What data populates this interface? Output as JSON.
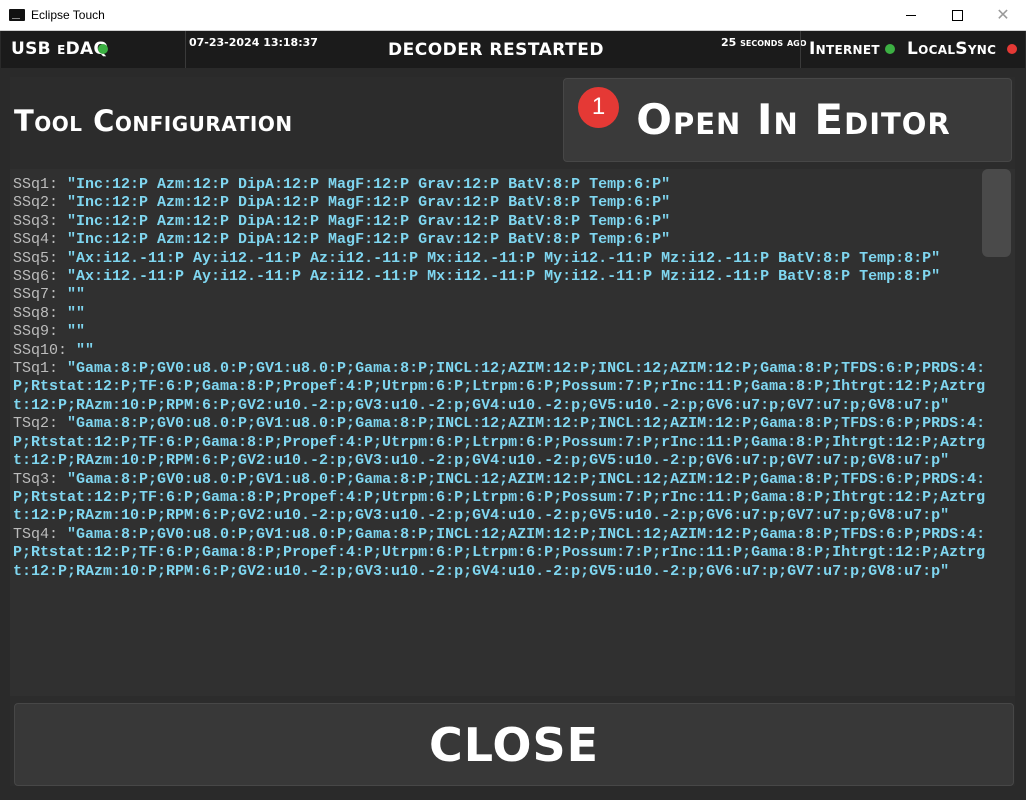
{
  "window": {
    "title": "Eclipse Touch",
    "minimize": "—",
    "maximize": "☐",
    "close": "✕"
  },
  "status": {
    "usb": {
      "label": "USB eDAQ",
      "dot_color": "#3cb043"
    },
    "date": "07-23-2024 13:18:37",
    "headline": "DECODER RESTARTED",
    "ago": "25 seconds ago",
    "internet": {
      "label": "Internet",
      "dot_color": "#3cb043"
    },
    "localsync": {
      "label": "LocalSync",
      "dot_color": "#e53935"
    }
  },
  "tool_config": {
    "title": "Tool Configuration"
  },
  "open_editor": {
    "label": "Open In Editor",
    "badge": "1"
  },
  "config_lines": [
    {
      "key": "SSq1: ",
      "value": "\"Inc:12:P Azm:12:P DipA:12:P MagF:12:P Grav:12:P BatV:8:P Temp:6:P\""
    },
    {
      "key": "SSq2: ",
      "value": "\"Inc:12:P Azm:12:P DipA:12:P MagF:12:P Grav:12:P BatV:8:P Temp:6:P\""
    },
    {
      "key": "SSq3: ",
      "value": "\"Inc:12:P Azm:12:P DipA:12:P MagF:12:P Grav:12:P BatV:8:P Temp:6:P\""
    },
    {
      "key": "SSq4: ",
      "value": "\"Inc:12:P Azm:12:P DipA:12:P MagF:12:P Grav:12:P BatV:8:P Temp:6:P\""
    },
    {
      "key": "SSq5: ",
      "value": "\"Ax:i12.-11:P Ay:i12.-11:P Az:i12.-11:P Mx:i12.-11:P My:i12.-11:P Mz:i12.-11:P BatV:8:P Temp:8:P\""
    },
    {
      "key": "SSq6: ",
      "value": "\"Ax:i12.-11:P Ay:i12.-11:P Az:i12.-11:P Mx:i12.-11:P My:i12.-11:P Mz:i12.-11:P BatV:8:P Temp:8:P\""
    },
    {
      "key": "SSq7: ",
      "value": "\"\""
    },
    {
      "key": "SSq8: ",
      "value": "\"\""
    },
    {
      "key": "SSq9: ",
      "value": "\"\""
    },
    {
      "key": "SSq10: ",
      "value": "\"\""
    },
    {
      "key": "TSq1: ",
      "value": "\"Gama:8:P;GV0:u8.0:P;GV1:u8.0:P;Gama:8:P;INCL:12;AZIM:12:P;INCL:12;AZIM:12:P;Gama:8:P;TFDS:6:P;PRDS:4:P;Rtstat:12:P;TF:6:P;Gama:8:P;Propef:4:P;Utrpm:6:P;Ltrpm:6:P;Possum:7:P;rInc:11:P;Gama:8:P;Ihtrgt:12:P;Aztrgt:12:P;RAzm:10:P;RPM:6:P;GV2:u10.-2:p;GV3:u10.-2:p;GV4:u10.-2:p;GV5:u10.-2:p;GV6:u7:p;GV7:u7:p;GV8:u7:p\""
    },
    {
      "key": "TSq2: ",
      "value": "\"Gama:8:P;GV0:u8.0:P;GV1:u8.0:P;Gama:8:P;INCL:12;AZIM:12:P;INCL:12;AZIM:12:P;Gama:8:P;TFDS:6:P;PRDS:4:P;Rtstat:12:P;TF:6:P;Gama:8:P;Propef:4:P;Utrpm:6:P;Ltrpm:6:P;Possum:7:P;rInc:11:P;Gama:8:P;Ihtrgt:12:P;Aztrgt:12:P;RAzm:10:P;RPM:6:P;GV2:u10.-2:p;GV3:u10.-2:p;GV4:u10.-2:p;GV5:u10.-2:p;GV6:u7:p;GV7:u7:p;GV8:u7:p\""
    },
    {
      "key": "TSq3: ",
      "value": "\"Gama:8:P;GV0:u8.0:P;GV1:u8.0:P;Gama:8:P;INCL:12;AZIM:12:P;INCL:12;AZIM:12:P;Gama:8:P;TFDS:6:P;PRDS:4:P;Rtstat:12:P;TF:6:P;Gama:8:P;Propef:4:P;Utrpm:6:P;Ltrpm:6:P;Possum:7:P;rInc:11:P;Gama:8:P;Ihtrgt:12:P;Aztrgt:12:P;RAzm:10:P;RPM:6:P;GV2:u10.-2:p;GV3:u10.-2:p;GV4:u10.-2:p;GV5:u10.-2:p;GV6:u7:p;GV7:u7:p;GV8:u7:p\""
    },
    {
      "key": "TSq4: ",
      "value": "\"Gama:8:P;GV0:u8.0:P;GV1:u8.0:P;Gama:8:P;INCL:12;AZIM:12:P;INCL:12;AZIM:12:P;Gama:8:P;TFDS:6:P;PRDS:4:P;Rtstat:12:P;TF:6:P;Gama:8:P;Propef:4:P;Utrpm:6:P;Ltrpm:6:P;Possum:7:P;rInc:11:P;Gama:8:P;Ihtrgt:12:P;Aztrgt:12:P;RAzm:10:P;RPM:6:P;GV2:u10.-2:p;GV3:u10.-2:p;GV4:u10.-2:p;GV5:u10.-2:p;GV6:u7:p;GV7:u7:p;GV8:u7:p\""
    }
  ],
  "close_button": {
    "label": "CLOSE"
  }
}
